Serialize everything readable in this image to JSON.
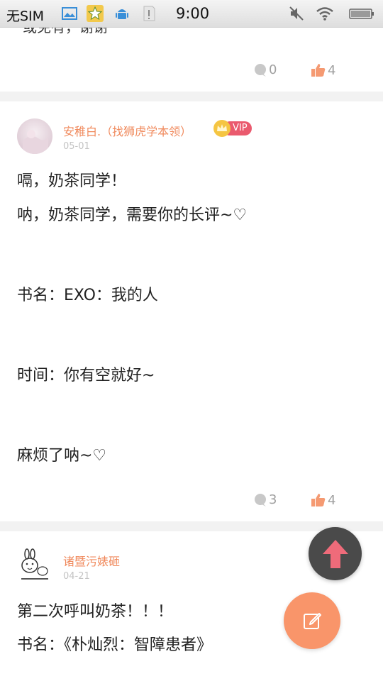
{
  "status_bar": {
    "carrier": "无SIM",
    "time": "9:00"
  },
  "previous_post": {
    "text_fragment": "或免有，谢谢",
    "comments": "0",
    "likes": "4"
  },
  "post1": {
    "author": "安稚白.（找狮虎学本领）",
    "vip": "VIP",
    "date": "05-01",
    "lines": [
      "嗝，奶茶同学！",
      " 呐，奶茶同学，需要你的长评~♡",
      " 书名：EXO：我的人",
      " 时间：你有空就好~",
      " 麻烦了呐~♡"
    ],
    "comments": "3",
    "likes": "4"
  },
  "post2": {
    "author": "诸暨污婊砸",
    "date": "04-21",
    "lines": [
      "第二次呼叫奶茶！！！",
      " 书名：《朴灿烈：智障患者》"
    ]
  },
  "colors": {
    "accent": "#f08a5d",
    "vip": "#ea5a6e",
    "fab_up_bg": "#4a4a4a",
    "fab_edit_bg": "#f9956a"
  }
}
